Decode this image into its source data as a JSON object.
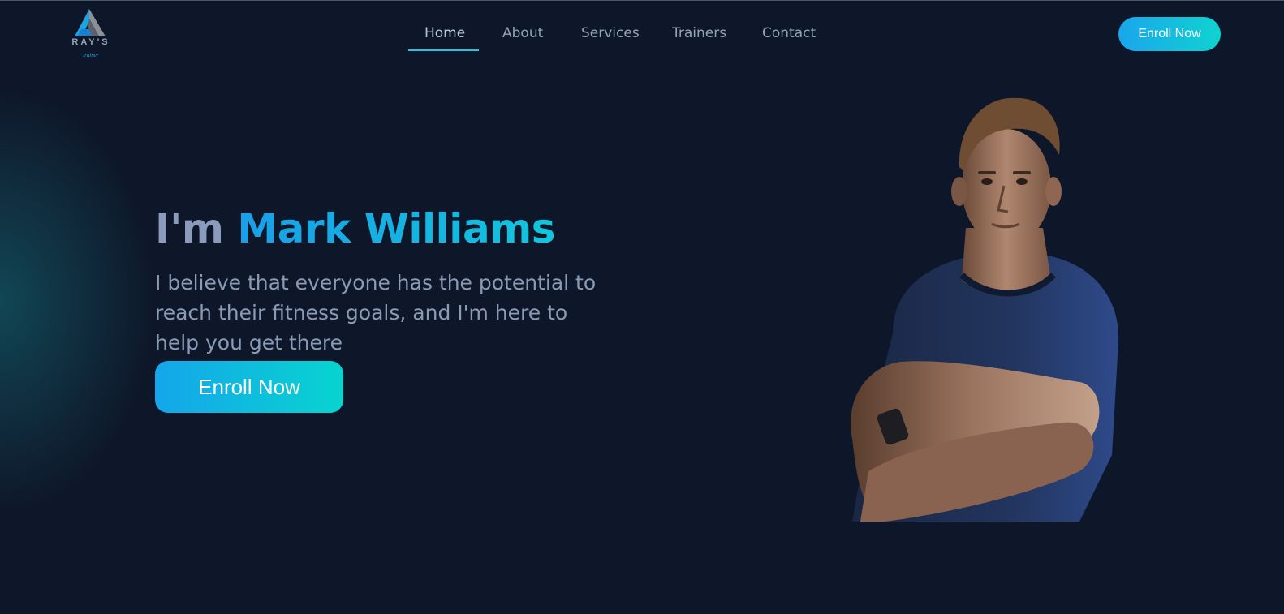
{
  "brand": {
    "logo_text": "RAY'S",
    "logo_subtext": "trainer",
    "accent_color": "#1fa3e0",
    "gradient_start": "#14a6ea",
    "gradient_end": "#08d4cf",
    "background_color": "#0e172a"
  },
  "nav": {
    "items": [
      {
        "label": "Home",
        "active": true
      },
      {
        "label": "About",
        "active": false
      },
      {
        "label": "Services",
        "active": false
      },
      {
        "label": "Trainers",
        "active": false
      },
      {
        "label": "Contact",
        "active": false
      }
    ],
    "cta_label": "Enroll Now"
  },
  "hero": {
    "title_prefix": "I'm ",
    "title_name": "Mark Williams",
    "description": "I believe that everyone has the potential to reach their fitness goals, and I'm here to help you get there",
    "cta_label": "Enroll Now",
    "image_icon": "trainer-portrait"
  }
}
